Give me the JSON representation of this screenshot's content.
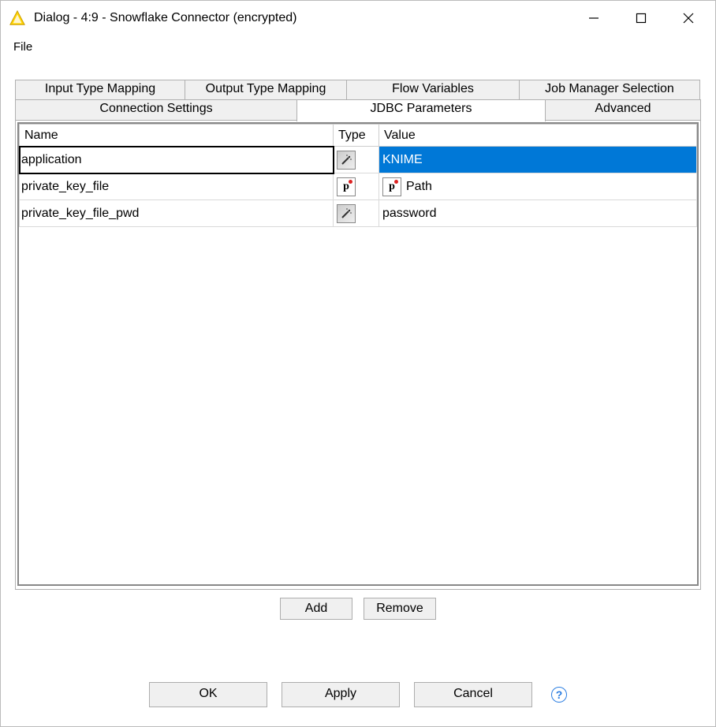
{
  "window": {
    "title": "Dialog - 4:9 - Snowflake Connector (encrypted)"
  },
  "menu": {
    "file": "File"
  },
  "tabs": {
    "row1": [
      "Input Type Mapping",
      "Output Type Mapping",
      "Flow Variables",
      "Job Manager Selection"
    ],
    "row2": [
      "Connection Settings",
      "JDBC Parameters",
      "Advanced"
    ],
    "active": "JDBC Parameters"
  },
  "table": {
    "headers": {
      "name": "Name",
      "type": "Type",
      "value": "Value"
    },
    "rows": [
      {
        "name": "application",
        "type_icon": "wand",
        "value_icon": null,
        "value": "KNIME",
        "selected": true
      },
      {
        "name": "private_key_file",
        "type_icon": "p",
        "value_icon": "p",
        "value": "Path",
        "selected": false
      },
      {
        "name": "private_key_file_pwd",
        "type_icon": "wand",
        "value_icon": null,
        "value": "password",
        "selected": false
      }
    ]
  },
  "buttons": {
    "add": "Add",
    "remove": "Remove",
    "ok": "OK",
    "apply": "Apply",
    "cancel": "Cancel",
    "help": "?"
  }
}
